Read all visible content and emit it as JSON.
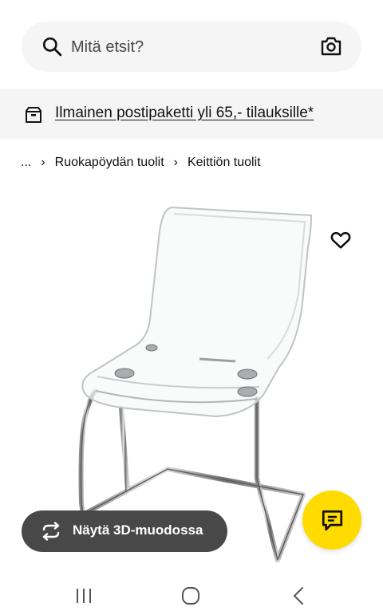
{
  "search": {
    "placeholder": "Mitä etsit?",
    "icon": "search-icon",
    "camera_icon": "camera-icon"
  },
  "promo": {
    "text": "Ilmainen postipaketti yli 65,- tilauksille*",
    "icon": "box-icon"
  },
  "breadcrumb": {
    "ellipsis": "...",
    "items": [
      "Ruokapöydän tuolit",
      "Keittiön tuolit"
    ],
    "separator": "›"
  },
  "product": {
    "wishlist_icon": "heart-icon"
  },
  "view_3d": {
    "label": "Näytä 3D-muodossa",
    "icon": "rotate-icon"
  },
  "chat": {
    "icon": "chat-icon",
    "color": "#ffdb00"
  },
  "colors": {
    "accent": "#ffdb00",
    "button_dark": "#484848",
    "surface": "#f5f5f5"
  }
}
